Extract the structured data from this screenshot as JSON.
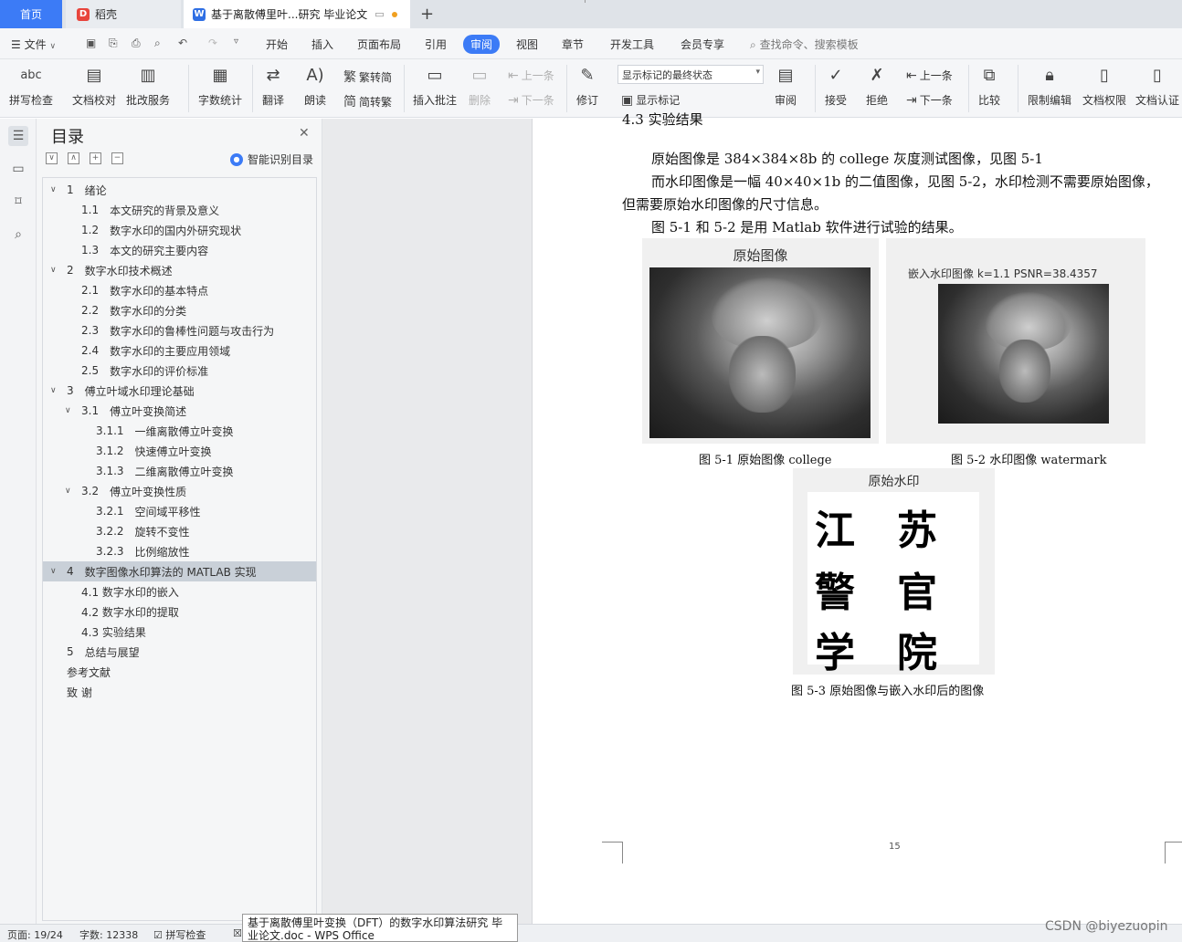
{
  "tabs": {
    "home": "首页",
    "daoke": "稻壳",
    "doc": "基于离散傅里叶...研究 毕业论文",
    "new_tab": "+"
  },
  "menubar": {
    "file": "文件",
    "items": [
      "开始",
      "插入",
      "页面布局",
      "引用",
      "审阅",
      "视图",
      "章节",
      "开发工具",
      "会员专享"
    ],
    "search": "查找命令、搜索模板"
  },
  "ribbon": {
    "spellcheck": "拼写检查",
    "doc_proof": "文档校对",
    "batch_service": "批改服务",
    "word_count": "字数统计",
    "translate": "翻译",
    "read_aloud": "朗读",
    "trad_to_simp": "繁转简",
    "simp_to_trad": "简转繁",
    "insert_comment": "插入批注",
    "delete": "删除",
    "prev_comment": "上一条",
    "next_comment": "下一条",
    "track_changes": "修订",
    "markup_status": "显示标记的最终状态",
    "show_markup": "显示标记",
    "review": "审阅",
    "accept": "接受",
    "reject": "拒绝",
    "prev_change": "上一条",
    "next_change": "下一条",
    "compare": "比较",
    "restrict_edit": "限制编辑",
    "doc_permission": "文档权限",
    "doc_certify": "文档认证"
  },
  "toc": {
    "title": "目录",
    "smart_detect": "智能识别目录",
    "items": [
      {
        "num": "1",
        "text": "绪论",
        "level": 1,
        "caret": "∨"
      },
      {
        "num": "1.1",
        "text": "本文研究的背景及意义",
        "level": 2,
        "caret": ""
      },
      {
        "num": "1.2",
        "text": "数字水印的国内外研究现状",
        "level": 2,
        "caret": ""
      },
      {
        "num": "1.3",
        "text": "本文的研究主要内容",
        "level": 2,
        "caret": ""
      },
      {
        "num": "2",
        "text": "数字水印技术概述",
        "level": 1,
        "caret": "∨"
      },
      {
        "num": "2.1",
        "text": "数字水印的基本特点",
        "level": 2,
        "caret": ""
      },
      {
        "num": "2.2",
        "text": "数字水印的分类",
        "level": 2,
        "caret": ""
      },
      {
        "num": "2.3",
        "text": "数字水印的鲁棒性问题与攻击行为",
        "level": 2,
        "caret": ""
      },
      {
        "num": "2.4",
        "text": "数字水印的主要应用领域",
        "level": 2,
        "caret": ""
      },
      {
        "num": "2.5",
        "text": "数字水印的评价标准",
        "level": 2,
        "caret": ""
      },
      {
        "num": "3",
        "text": "傅立叶域水印理论基础",
        "level": 1,
        "caret": "∨"
      },
      {
        "num": "3.1",
        "text": "傅立叶变换简述",
        "level": 2,
        "caret": "∨"
      },
      {
        "num": "3.1.1",
        "text": "一维离散傅立叶变换",
        "level": 3,
        "caret": ""
      },
      {
        "num": "3.1.2",
        "text": "快速傅立叶变换",
        "level": 3,
        "caret": ""
      },
      {
        "num": "3.1.3",
        "text": "二维离散傅立叶变换",
        "level": 3,
        "caret": ""
      },
      {
        "num": "3.2",
        "text": "傅立叶变换性质",
        "level": 2,
        "caret": "∨"
      },
      {
        "num": "3.2.1",
        "text": "空间域平移性",
        "level": 3,
        "caret": ""
      },
      {
        "num": "3.2.2",
        "text": "旋转不变性",
        "level": 3,
        "caret": ""
      },
      {
        "num": "3.2.3",
        "text": "比例缩放性",
        "level": 3,
        "caret": ""
      },
      {
        "num": "4",
        "text": "数字图像水印算法的 MATLAB  实现",
        "level": 1,
        "caret": "∨",
        "active": true
      },
      {
        "num": "",
        "text": "4.1 数字水印的嵌入",
        "level": 2,
        "caret": ""
      },
      {
        "num": "",
        "text": "4.2 数字水印的提取",
        "level": 2,
        "caret": ""
      },
      {
        "num": "",
        "text": "4.3 实验结果",
        "level": 2,
        "caret": ""
      },
      {
        "num": "5",
        "text": "总结与展望",
        "level": 1,
        "caret": ""
      },
      {
        "num": "",
        "text": "参考文献",
        "level": 1,
        "caret": ""
      },
      {
        "num": "",
        "text": "致   谢",
        "level": 1,
        "caret": ""
      }
    ]
  },
  "document": {
    "section_heading": "4.3 实验结果",
    "para1": "原始图像是 384×384×8b 的 college 灰度测试图像，见图 5-1",
    "para2a": "而水印图像是一幅 40×40×1b 的二值图像，见图 5-2，水印检测不需要原始图像，",
    "para2b": "但需要原始水印图像的尺寸信息。",
    "para3": "图 5-1 和 5-2 是用 Matlab 软件进行试验的结果。",
    "fig1_title": "原始图像",
    "fig1_caption": "图 5-1  原始图像 college",
    "fig2_title": "嵌入水印图像    k=1.1    PSNR=38.4357",
    "fig2_caption": "图 5-2 水印图像 watermark",
    "fig3_title": "原始水印",
    "fig3_chars": [
      "江",
      "苏",
      "警",
      "官",
      "学",
      "院"
    ],
    "fig3_caption": "图 5-3  原始图像与嵌入水印后的图像",
    "page_number": "15"
  },
  "statusbar": {
    "page": "页面: 19/24",
    "words": "字数: 12338",
    "spellcheck": "拼写检查",
    "tooltip": "基于离散傅里叶变换（DFT）的数字水印算法研究 毕业论文.doc - WPS Office"
  },
  "watermark": "CSDN @biyezuopin"
}
